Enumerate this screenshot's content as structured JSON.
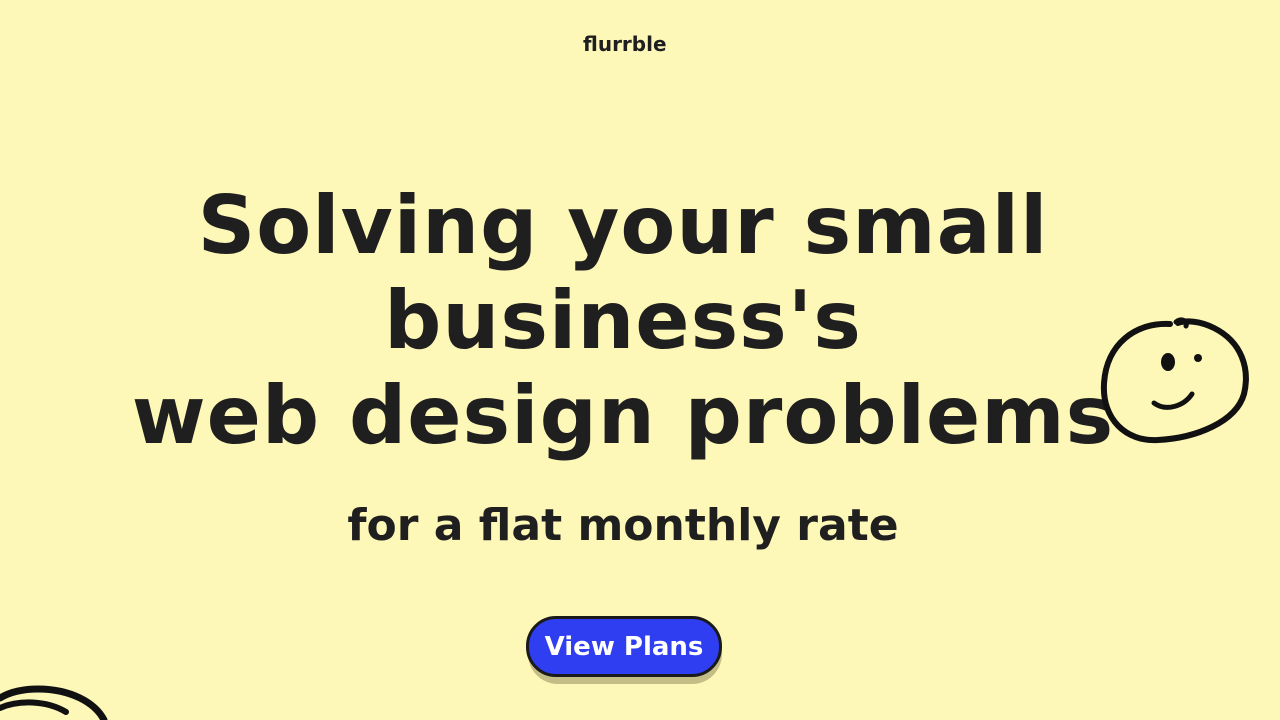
{
  "header": {
    "logo_text": "flurrble"
  },
  "hero": {
    "headline_lines": [
      "Solving your small",
      "business's",
      "web design problems"
    ],
    "subheadline": "for a flat monthly rate",
    "cta_label": "View Plans"
  },
  "colors": {
    "background": "#fdf7b8",
    "text": "#1f1f1f",
    "cta_background": "#2f3ef0",
    "cta_text": "#ffffff",
    "cta_shadow": "#c4bd86"
  },
  "decorations": {
    "face_doodle": "smiley-face-doodle-icon",
    "corner_doodle": "scribble-doodle-icon"
  }
}
